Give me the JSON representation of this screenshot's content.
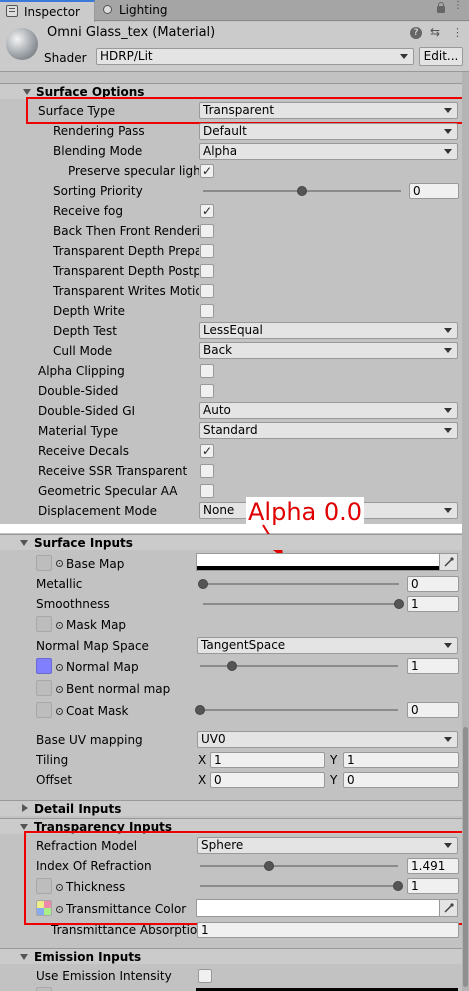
{
  "tabs": {
    "inspector": "Inspector",
    "lighting": "Lighting"
  },
  "material": {
    "name": "Omni Glass_tex (Material)",
    "shader_label": "Shader",
    "shader_value": "HDRP/Lit",
    "edit_label": "Edit..."
  },
  "surface_options": {
    "title": "Surface Options",
    "surface_type": {
      "label": "Surface Type",
      "value": "Transparent"
    },
    "rendering_pass": {
      "label": "Rendering Pass",
      "value": "Default"
    },
    "blending_mode": {
      "label": "Blending Mode",
      "value": "Alpha"
    },
    "preserve_specular": {
      "label": "Preserve specular lighti",
      "checked": true
    },
    "sorting_priority": {
      "label": "Sorting Priority",
      "value": "0"
    },
    "receive_fog": {
      "label": "Receive fog",
      "checked": true
    },
    "back_then_front": {
      "label": "Back Then Front Renderin",
      "checked": false
    },
    "transparent_depth_prepass": {
      "label": "Transparent Depth Prepas",
      "checked": false
    },
    "transparent_depth_postpass": {
      "label": "Transparent Depth Postpa",
      "checked": false
    },
    "transparent_writes_motion": {
      "label": "Transparent Writes Motior",
      "checked": false
    },
    "depth_write": {
      "label": "Depth Write",
      "checked": false
    },
    "depth_test": {
      "label": "Depth Test",
      "value": "LessEqual"
    },
    "cull_mode": {
      "label": "Cull Mode",
      "value": "Back"
    },
    "alpha_clipping": {
      "label": "Alpha Clipping",
      "checked": false
    },
    "double_sided": {
      "label": "Double-Sided",
      "checked": false
    },
    "double_sided_gi": {
      "label": "Double-Sided GI",
      "value": "Auto"
    },
    "material_type": {
      "label": "Material Type",
      "value": "Standard"
    },
    "receive_decals": {
      "label": "Receive Decals",
      "checked": true
    },
    "receive_ssr": {
      "label": "Receive SSR Transparent",
      "checked": false
    },
    "geometric_specular_aa": {
      "label": "Geometric Specular AA",
      "checked": false
    },
    "displacement_mode": {
      "label": "Displacement Mode",
      "value": "None"
    }
  },
  "annotation": {
    "text": "Alpha 0.0",
    "color": "#e00000"
  },
  "surface_inputs": {
    "title": "Surface Inputs",
    "base_map": {
      "label": "Base Map"
    },
    "metallic": {
      "label": "Metallic",
      "value": "0"
    },
    "smoothness": {
      "label": "Smoothness",
      "value": "1"
    },
    "mask_map": {
      "label": "Mask Map"
    },
    "normal_map_space": {
      "label": "Normal Map Space",
      "value": "TangentSpace"
    },
    "normal_map": {
      "label": "Normal Map",
      "value": "1"
    },
    "bent_normal_map": {
      "label": "Bent normal map"
    },
    "coat_mask": {
      "label": "Coat Mask",
      "value": "0"
    },
    "base_uv_mapping": {
      "label": "Base UV mapping",
      "value": "UV0"
    },
    "tiling": {
      "label": "Tiling",
      "x_label": "X",
      "x": "1",
      "y_label": "Y",
      "y": "1"
    },
    "offset": {
      "label": "Offset",
      "x_label": "X",
      "x": "0",
      "y_label": "Y",
      "y": "0"
    }
  },
  "detail_inputs": {
    "title": "Detail Inputs"
  },
  "transparency_inputs": {
    "title": "Transparency Inputs",
    "refraction_model": {
      "label": "Refraction Model",
      "value": "Sphere"
    },
    "index_of_refraction": {
      "label": "Index Of Refraction",
      "value": "1.491"
    },
    "thickness": {
      "label": "Thickness",
      "value": "1"
    },
    "transmittance_color": {
      "label": "Transmittance Color"
    },
    "transmittance_absorption": {
      "label": "Transmittance Absorption",
      "value": "1"
    }
  },
  "emission_inputs": {
    "title": "Emission Inputs",
    "use_emission_intensity": {
      "label": "Use Emission Intensity",
      "checked": false
    }
  },
  "colors": {
    "panel_bg": "#c2c2c2",
    "highlight_red": "#e00000",
    "normal_map_swatch": "#8080ff"
  },
  "slider_levels": {
    "sorting_priority": 0.5,
    "metallic": 0.0,
    "smoothness": 1.0,
    "normal_map": 0.16,
    "coat_mask": 0.0,
    "index_of_refraction": 0.35,
    "thickness": 1.0
  }
}
